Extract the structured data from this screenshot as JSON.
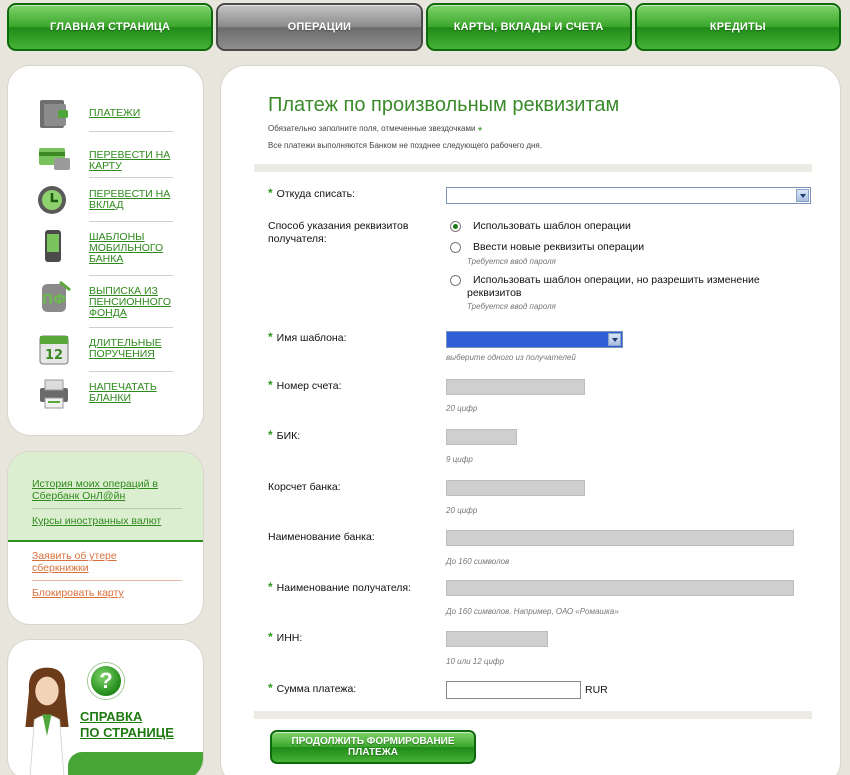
{
  "nav": {
    "tabs": [
      {
        "label": "ГЛАВНАЯ СТРАНИЦА",
        "active": false
      },
      {
        "label": "ОПЕРАЦИИ",
        "active": true
      },
      {
        "label": "КАРТЫ, ВКЛАДЫ И СЧЕТА",
        "active": false
      },
      {
        "label": "КРЕДИТЫ",
        "active": false
      }
    ]
  },
  "sidebar": {
    "items": [
      {
        "label": "ПЛАТЕЖИ",
        "icon": "wallet-icon"
      },
      {
        "label": "ПЕРЕВЕСТИ НА КАРТУ",
        "icon": "card-transfer-icon"
      },
      {
        "label": "ПЕРЕВЕСТИ НА ВКЛАД",
        "icon": "deposit-clock-icon"
      },
      {
        "label": "ШАБЛОНЫ МОБИЛЬНОГО БАНКА",
        "icon": "mobile-phone-icon"
      },
      {
        "label": "ВЫПИСКА ИЗ ПЕНСИОННОГО ФОНДА",
        "icon": "pension-fund-icon"
      },
      {
        "label": "ДЛИТЕЛЬНЫЕ ПОРУЧЕНИЯ",
        "icon": "calendar-icon"
      },
      {
        "label": "НАПЕЧАТАТЬ БЛАНКИ",
        "icon": "printer-icon"
      }
    ],
    "links": {
      "history": "История моих операций в Сбербанк ОнЛ@йн",
      "rates": "Курсы иностранных валют",
      "lost_book": "Заявить об утере сберкнижки",
      "block_card": "Блокировать карту"
    },
    "help": {
      "line1": "СПРАВКА",
      "line2": "ПО СТРАНИЦЕ",
      "icon_glyph": "?"
    }
  },
  "form": {
    "title": "Платеж по произвольным реквизитам",
    "note_required": "Обязательно заполните поля, отмеченные звездочками",
    "note_required_mark": "*",
    "note_timing": "Все платежи выполняются Банком не позднее следующего рабочего дня.",
    "required_mark": "*",
    "from_label": "Откуда списать:",
    "method_label": "Способ указания реквизитов получателя:",
    "options": [
      {
        "label": "Использовать шаблон операции",
        "hint": "",
        "selected": true
      },
      {
        "label": "Ввести новые реквизиты операции",
        "hint": "Требуется ввод пароля",
        "selected": false
      },
      {
        "label": "Использовать шаблон операции, но разрешить изменение реквизитов",
        "hint": "Требуется ввод пароля",
        "selected": false
      }
    ],
    "template_label": "Имя шаблона:",
    "template_hint": "выберите одного из получателей",
    "account_label": "Номер счета:",
    "account_hint": "20 цифр",
    "bik_label": "БИК:",
    "bik_hint": "9 цифр",
    "corr_label": "Корсчет банка:",
    "corr_hint": "20 цифр",
    "bankname_label": "Наименование банка:",
    "bankname_hint": "До 160 символов",
    "recipient_label": "Наименование получателя:",
    "recipient_hint": "До 160 символов. Например, ОАО «Ромашка»",
    "inn_label": "ИНН:",
    "inn_hint": "10 или 12 цифр",
    "amount_label": "Сумма платежа:",
    "currency": "RUR",
    "submit": "ПРОДОЛЖИТЬ ФОРМИРОВАНИЕ ПЛАТЕЖА"
  },
  "colors": {
    "brand_green": "#3aa62b",
    "title_green": "#3a8a2a",
    "link_orange": "#d9713d"
  }
}
